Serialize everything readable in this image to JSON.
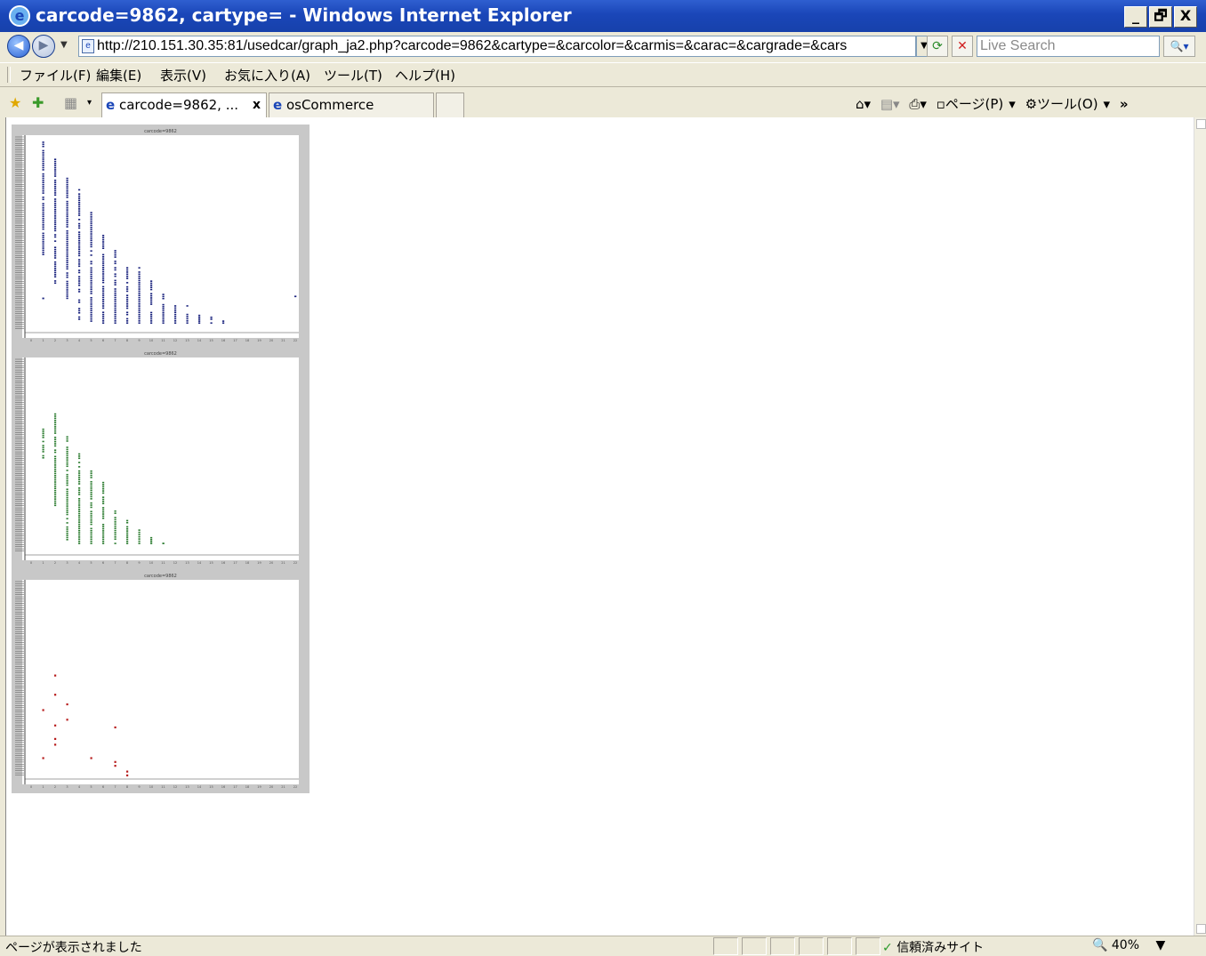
{
  "window": {
    "title": "carcode=9862, cartype= - Windows Internet Explorer",
    "minimize": "_",
    "restore": "🗗",
    "close": "X"
  },
  "address": {
    "url": "http://210.151.30.35:81/usedcar/graph_ja2.php?carcode=9862&cartype=&carcolor=&carmis=&carac=&cargrade=&cars",
    "search_placeholder": "Live Search"
  },
  "menu": [
    "ファイル(F)",
    "編集(E)",
    "表示(V)",
    "お気に入り(A)",
    "ツール(T)",
    "ヘルプ(H)"
  ],
  "tabs": [
    {
      "label": "carcode=9862, ...",
      "close": "x",
      "active": true
    },
    {
      "label": "osCommerce",
      "active": false
    }
  ],
  "commandbar": {
    "page": "ページ(P)",
    "tools": "ツール(O)",
    "more": "»"
  },
  "status": {
    "text": "ページが表示されました",
    "zone": "信頼済みサイト",
    "zoom": "40%"
  },
  "colors": {
    "series_blue": "#1a237e",
    "series_green": "#2e7d32",
    "series_red": "#b71c1c",
    "titlebar": "#1a46b8"
  },
  "chart_data": [
    {
      "type": "scatter",
      "title": "carcode=9862",
      "color": "#1a237e",
      "x_ticks": [
        0,
        1,
        2,
        3,
        4,
        5,
        6,
        7,
        8,
        9,
        10,
        11,
        12,
        13,
        14,
        15,
        16,
        17,
        18,
        19,
        20,
        21,
        22
      ],
      "columns": [
        {
          "x": 1,
          "top": 0.99,
          "bottom": 0.4,
          "outliers": [
            0.17
          ]
        },
        {
          "x": 2,
          "top": 0.9,
          "bottom": 0.25
        },
        {
          "x": 3,
          "top": 0.8,
          "bottom": 0.17
        },
        {
          "x": 4,
          "top": 0.74,
          "bottom": 0.06
        },
        {
          "x": 5,
          "top": 0.62,
          "bottom": 0.05
        },
        {
          "x": 6,
          "top": 0.5,
          "bottom": 0.04
        },
        {
          "x": 7,
          "top": 0.42,
          "bottom": 0.04
        },
        {
          "x": 8,
          "top": 0.33,
          "bottom": 0.04
        },
        {
          "x": 9,
          "top": 0.33,
          "bottom": 0.04
        },
        {
          "x": 10,
          "top": 0.26,
          "bottom": 0.04
        },
        {
          "x": 11,
          "top": 0.19,
          "bottom": 0.04
        },
        {
          "x": 12,
          "top": 0.13,
          "bottom": 0.04
        },
        {
          "x": 13,
          "top": 0.13,
          "bottom": 0.04
        },
        {
          "x": 14,
          "top": 0.08,
          "bottom": 0.04
        },
        {
          "x": 15,
          "top": 0.07,
          "bottom": 0.04
        },
        {
          "x": 16,
          "top": 0.05,
          "bottom": 0.04
        },
        {
          "x": 22,
          "top": 0.18,
          "bottom": 0.18
        }
      ]
    },
    {
      "type": "scatter",
      "title": "carcode=9862",
      "color": "#2e7d32",
      "x_ticks": [
        0,
        1,
        2,
        3,
        4,
        5,
        6,
        7,
        8,
        9,
        10,
        11,
        12,
        13,
        14,
        15,
        16,
        17,
        18,
        19,
        20,
        21,
        22
      ],
      "columns": [
        {
          "x": 1,
          "top": 0.65,
          "bottom": 0.5
        },
        {
          "x": 2,
          "top": 0.73,
          "bottom": 0.25
        },
        {
          "x": 3,
          "top": 0.61,
          "bottom": 0.07
        },
        {
          "x": 4,
          "top": 0.52,
          "bottom": 0.05
        },
        {
          "x": 5,
          "top": 0.43,
          "bottom": 0.05
        },
        {
          "x": 6,
          "top": 0.37,
          "bottom": 0.05
        },
        {
          "x": 7,
          "top": 0.22,
          "bottom": 0.05
        },
        {
          "x": 8,
          "top": 0.17,
          "bottom": 0.05
        },
        {
          "x": 9,
          "top": 0.12,
          "bottom": 0.05
        },
        {
          "x": 10,
          "top": 0.08,
          "bottom": 0.05
        },
        {
          "x": 11,
          "top": 0.05,
          "bottom": 0.05
        }
      ]
    },
    {
      "type": "scatter",
      "title": "carcode=9862",
      "color": "#b71c1c",
      "x_ticks": [
        0,
        1,
        2,
        3,
        4,
        5,
        6,
        7,
        8,
        9,
        10,
        11,
        12,
        13,
        14,
        15,
        16,
        17,
        18,
        19,
        20,
        21,
        22
      ],
      "points": [
        {
          "x": 1,
          "y": 0.35
        },
        {
          "x": 1,
          "y": 0.1
        },
        {
          "x": 2,
          "y": 0.53
        },
        {
          "x": 2,
          "y": 0.43
        },
        {
          "x": 2,
          "y": 0.27
        },
        {
          "x": 2,
          "y": 0.2
        },
        {
          "x": 2,
          "y": 0.17
        },
        {
          "x": 3,
          "y": 0.38
        },
        {
          "x": 3,
          "y": 0.3
        },
        {
          "x": 5,
          "y": 0.1
        },
        {
          "x": 7,
          "y": 0.26
        },
        {
          "x": 7,
          "y": 0.08
        },
        {
          "x": 7,
          "y": 0.06
        },
        {
          "x": 8,
          "y": 0.03
        },
        {
          "x": 8,
          "y": 0.01
        }
      ]
    }
  ]
}
